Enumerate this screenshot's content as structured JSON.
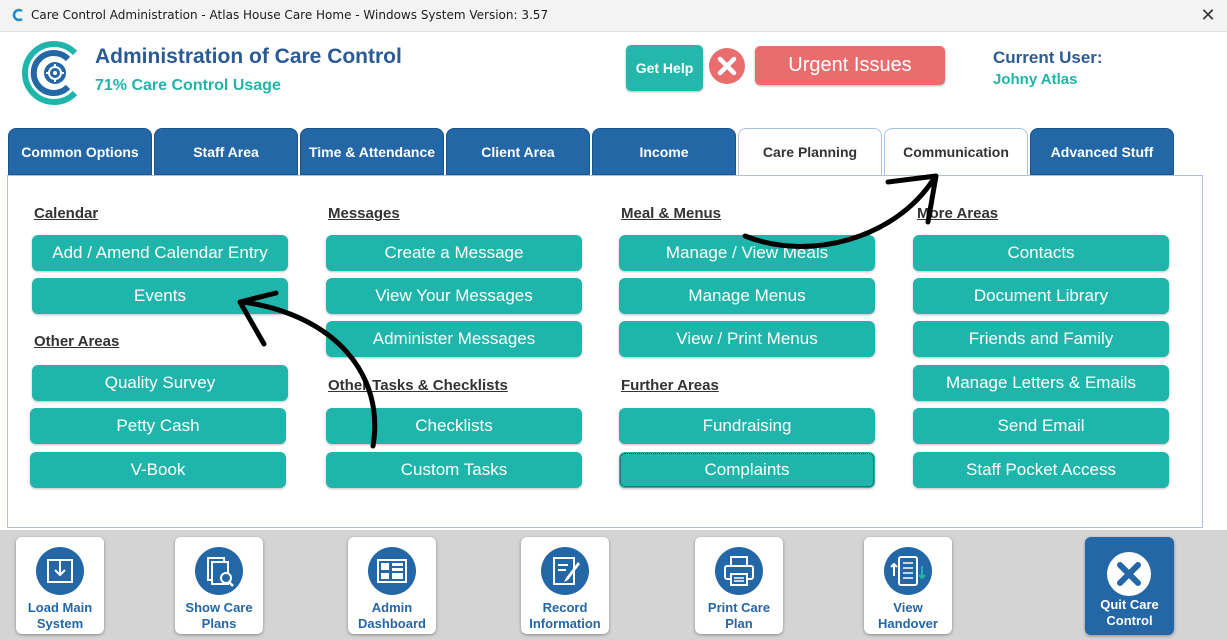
{
  "window": {
    "title": "Care Control Administration - Atlas House Care Home - Windows System Version: 3.57",
    "close_glyph": "✕"
  },
  "header": {
    "title": "Administration of Care Control",
    "usage": "71% Care Control Usage",
    "help_label": "Get Help",
    "urgent_label": "Urgent Issues",
    "user_label": "Current User:",
    "user_name": "Johny Atlas"
  },
  "tabs": [
    {
      "label": "Common Options"
    },
    {
      "label": "Staff Area"
    },
    {
      "label": "Time & Attendance"
    },
    {
      "label": "Client Area"
    },
    {
      "label": "Income"
    },
    {
      "label": "Care Planning"
    },
    {
      "label": "Communication"
    },
    {
      "label": "Advanced Stuff"
    }
  ],
  "sections": {
    "calendar": {
      "title": "Calendar",
      "items": [
        "Add / Amend Calendar Entry",
        "Events"
      ]
    },
    "other_areas": {
      "title": "Other Areas",
      "items": [
        "Quality Survey",
        "Petty Cash",
        "V-Book"
      ]
    },
    "messages": {
      "title": "Messages",
      "items": [
        "Create a Message",
        "View Your Messages",
        "Administer Messages"
      ]
    },
    "tasks": {
      "title": "Other Tasks & Checklists",
      "items": [
        "Checklists",
        "Custom Tasks"
      ]
    },
    "meals": {
      "title": "Meal & Menus",
      "items": [
        "Manage / View Meals",
        "Manage Menus",
        "View / Print Menus"
      ]
    },
    "further": {
      "title": "Further Areas",
      "items": [
        "Fundraising",
        "Complaints"
      ]
    },
    "more": {
      "title": "More Areas",
      "items": [
        "Contacts",
        "Document Library",
        "Friends and Family",
        "Manage Letters & Emails",
        "Send Email",
        "Staff Pocket Access"
      ]
    }
  },
  "bottom": [
    {
      "label": "Load Main\nSystem",
      "icon": "load-icon"
    },
    {
      "label": "Show Care\nPlans",
      "icon": "care-plans-icon"
    },
    {
      "label": "Admin\nDashboard",
      "icon": "dashboard-icon"
    },
    {
      "label": "Record\nInformation",
      "icon": "record-icon"
    },
    {
      "label": "Print Care\nPlan",
      "icon": "printer-icon"
    },
    {
      "label": "View\nHandover",
      "icon": "handover-icon"
    },
    {
      "label": "Quit Care\nControl",
      "icon": "quit-icon"
    }
  ],
  "colors": {
    "teal": "#20b5aa",
    "blue": "#2367a7",
    "red": "#e86d6c",
    "title_blue": "#2b5a94"
  }
}
